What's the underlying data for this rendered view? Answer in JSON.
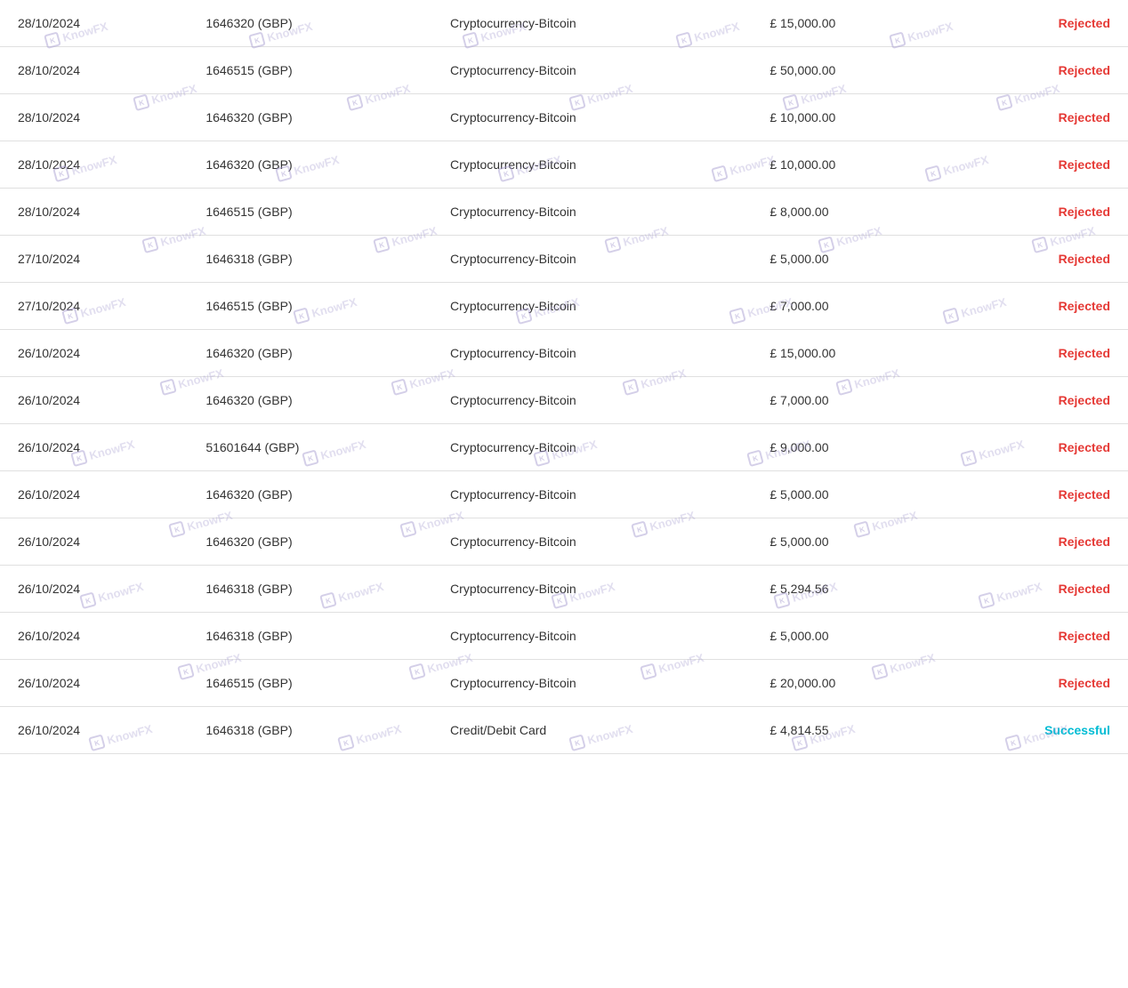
{
  "table": {
    "rows": [
      {
        "date": "28/10/2024",
        "account": "1646320 (GBP)",
        "method": "Cryptocurrency-Bitcoin",
        "amount": "£  15,000.00",
        "status": "Rejected",
        "status_type": "rejected"
      },
      {
        "date": "28/10/2024",
        "account": "1646515 (GBP)",
        "method": "Cryptocurrency-Bitcoin",
        "amount": "£  50,000.00",
        "status": "Rejected",
        "status_type": "rejected"
      },
      {
        "date": "28/10/2024",
        "account": "1646320 (GBP)",
        "method": "Cryptocurrency-Bitcoin",
        "amount": "£  10,000.00",
        "status": "Rejected",
        "status_type": "rejected"
      },
      {
        "date": "28/10/2024",
        "account": "1646320 (GBP)",
        "method": "Cryptocurrency-Bitcoin",
        "amount": "£  10,000.00",
        "status": "Rejected",
        "status_type": "rejected"
      },
      {
        "date": "28/10/2024",
        "account": "1646515 (GBP)",
        "method": "Cryptocurrency-Bitcoin",
        "amount": "£  8,000.00",
        "status": "Rejected",
        "status_type": "rejected"
      },
      {
        "date": "27/10/2024",
        "account": "1646318 (GBP)",
        "method": "Cryptocurrency-Bitcoin",
        "amount": "£  5,000.00",
        "status": "Rejected",
        "status_type": "rejected"
      },
      {
        "date": "27/10/2024",
        "account": "1646515 (GBP)",
        "method": "Cryptocurrency-Bitcoin",
        "amount": "£  7,000.00",
        "status": "Rejected",
        "status_type": "rejected"
      },
      {
        "date": "26/10/2024",
        "account": "1646320 (GBP)",
        "method": "Cryptocurrency-Bitcoin",
        "amount": "£  15,000.00",
        "status": "Rejected",
        "status_type": "rejected"
      },
      {
        "date": "26/10/2024",
        "account": "1646320 (GBP)",
        "method": "Cryptocurrency-Bitcoin",
        "amount": "£  7,000.00",
        "status": "Rejected",
        "status_type": "rejected"
      },
      {
        "date": "26/10/2024",
        "account": "51601644 (GBP)",
        "method": "Cryptocurrency-Bitcoin",
        "amount": "£  9,000.00",
        "status": "Rejected",
        "status_type": "rejected"
      },
      {
        "date": "26/10/2024",
        "account": "1646320 (GBP)",
        "method": "Cryptocurrency-Bitcoin",
        "amount": "£  5,000.00",
        "status": "Rejected",
        "status_type": "rejected"
      },
      {
        "date": "26/10/2024",
        "account": "1646320 (GBP)",
        "method": "Cryptocurrency-Bitcoin",
        "amount": "£  5,000.00",
        "status": "Rejected",
        "status_type": "rejected"
      },
      {
        "date": "26/10/2024",
        "account": "1646318 (GBP)",
        "method": "Cryptocurrency-Bitcoin",
        "amount": "£  5,294.56",
        "status": "Rejected",
        "status_type": "rejected"
      },
      {
        "date": "26/10/2024",
        "account": "1646318 (GBP)",
        "method": "Cryptocurrency-Bitcoin",
        "amount": "£  5,000.00",
        "status": "Rejected",
        "status_type": "rejected"
      },
      {
        "date": "26/10/2024",
        "account": "1646515 (GBP)",
        "method": "Cryptocurrency-Bitcoin",
        "amount": "£  20,000.00",
        "status": "Rejected",
        "status_type": "rejected"
      },
      {
        "date": "26/10/2024",
        "account": "1646318 (GBP)",
        "method": "Credit/Debit Card",
        "amount": "£  4,814.55",
        "status": "Successful",
        "status_type": "successful"
      }
    ]
  }
}
